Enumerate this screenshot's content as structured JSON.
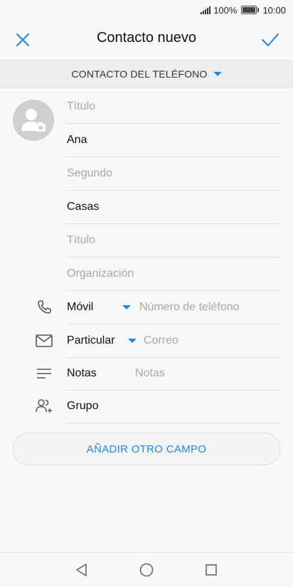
{
  "status_bar": {
    "battery_text": "100%",
    "time": "10:00"
  },
  "header": {
    "title": "Contacto nuevo",
    "close_icon": "close-icon",
    "confirm_icon": "check-icon"
  },
  "account": {
    "label": "CONTACTO DEL TELÉFONO"
  },
  "fields": {
    "title_placeholder": "Título",
    "first_name": "Ana",
    "middle_placeholder": "Segundo",
    "last_name": "Casas",
    "job_title_placeholder": "Título",
    "organization_placeholder": "Organización"
  },
  "phone": {
    "type_label": "Móvil",
    "placeholder": "Número de teléfono"
  },
  "email": {
    "type_label": "Particular",
    "placeholder": "Correo"
  },
  "notes": {
    "label": "Notas",
    "placeholder": "Notas"
  },
  "group": {
    "label": "Grupo"
  },
  "add_field": {
    "label": "AÑADIR OTRO CAMPO"
  },
  "colors": {
    "accent": "#1e88e5",
    "placeholder": "#a8a8a8",
    "divider": "#dedede"
  }
}
